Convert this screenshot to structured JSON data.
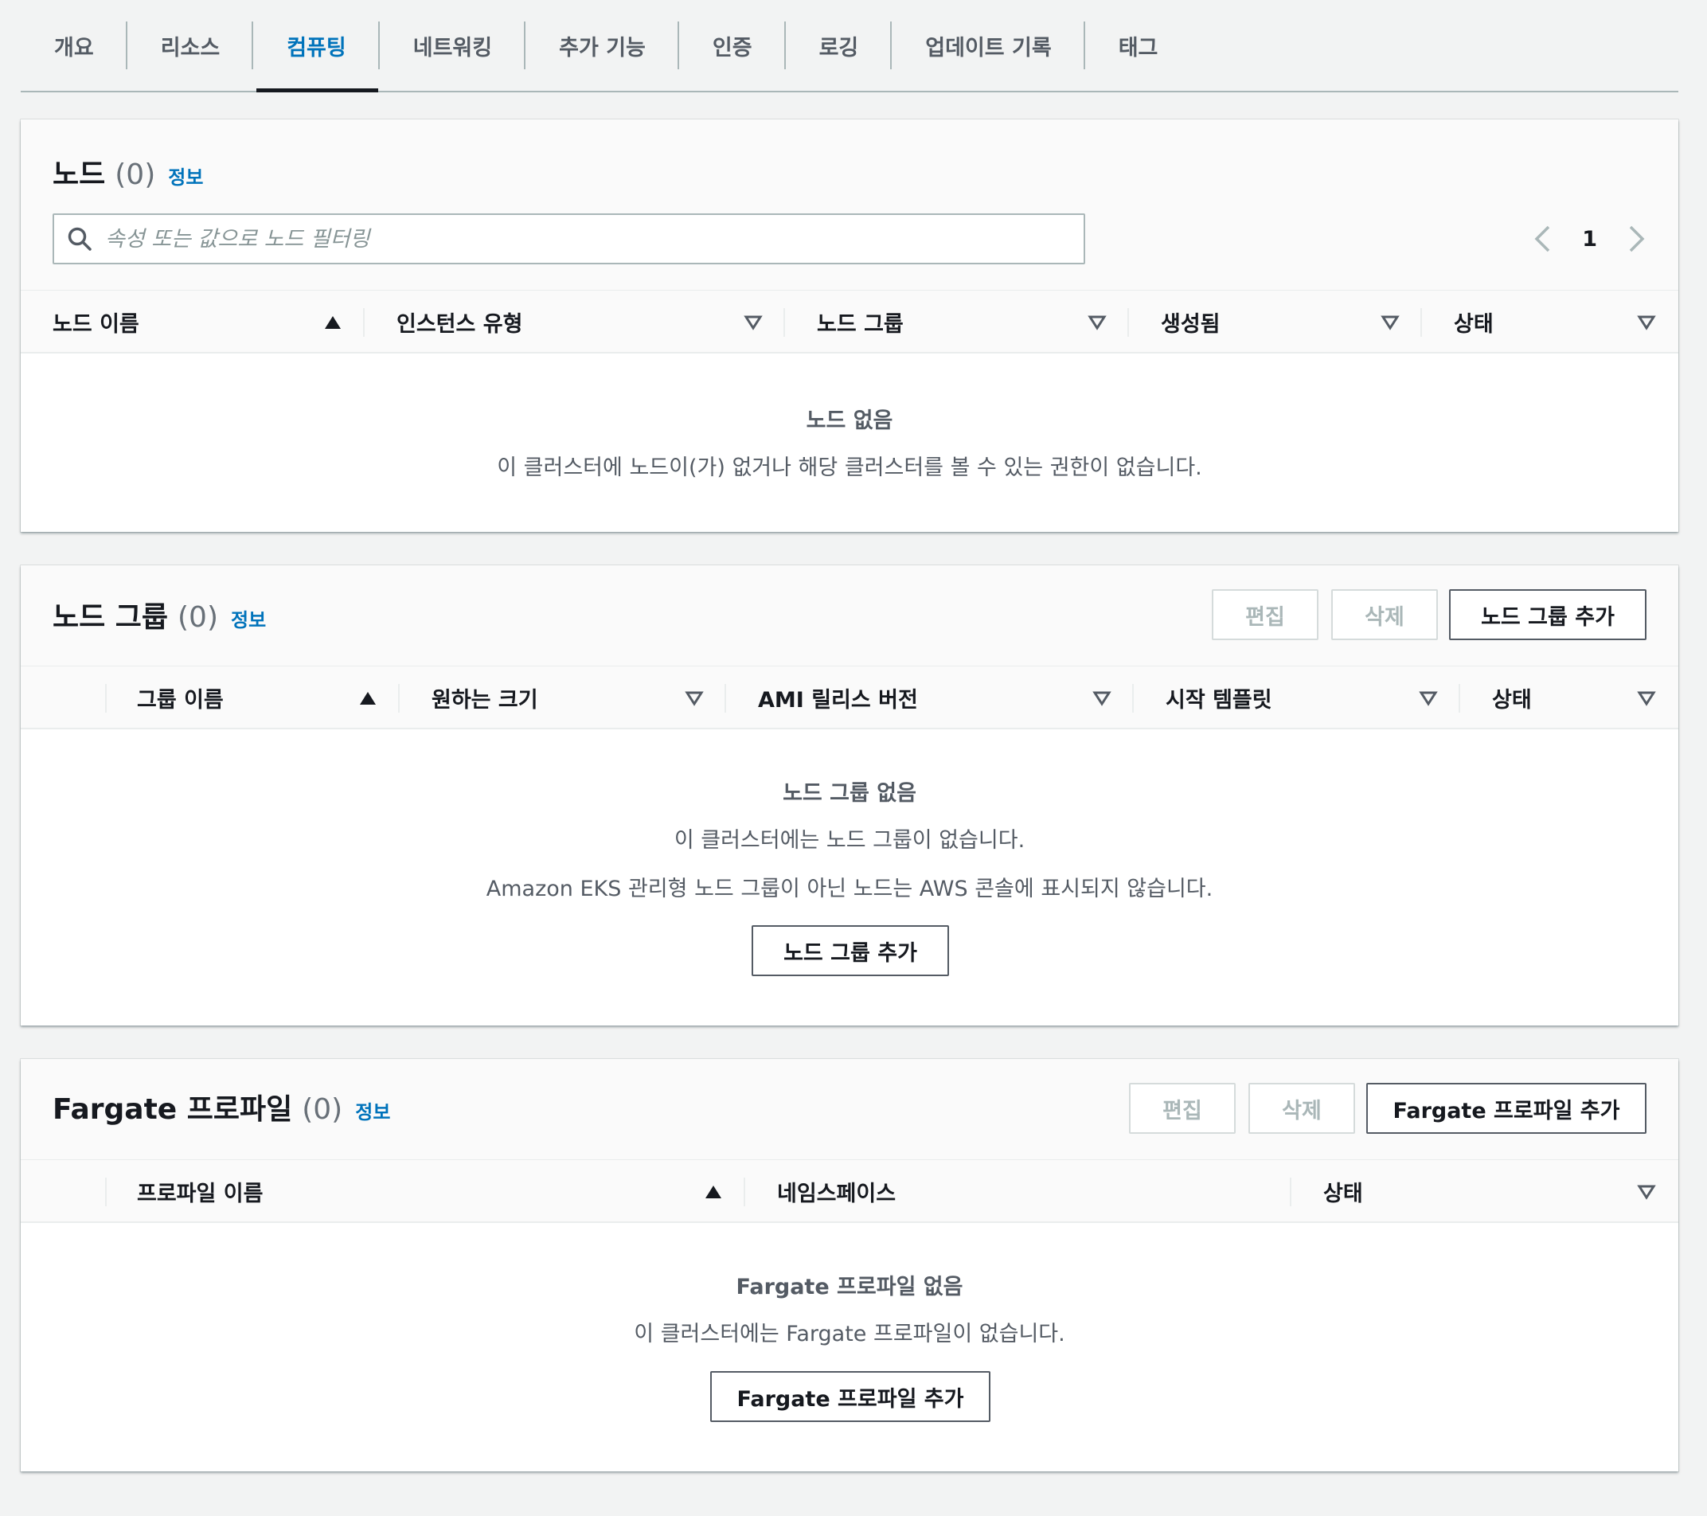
{
  "tabs": [
    {
      "label": "개요"
    },
    {
      "label": "리소스"
    },
    {
      "label": "컴퓨팅",
      "active": true
    },
    {
      "label": "네트워킹"
    },
    {
      "label": "추가 기능"
    },
    {
      "label": "인증"
    },
    {
      "label": "로깅"
    },
    {
      "label": "업데이트 기록"
    },
    {
      "label": "태그"
    }
  ],
  "nodes": {
    "title": "노드",
    "count": "(0)",
    "info": "정보",
    "search_placeholder": "속성 또는 값으로 노드 필터링",
    "page": "1",
    "columns": [
      "노드 이름",
      "인스턴스 유형",
      "노드 그룹",
      "생성됨",
      "상태"
    ],
    "empty_title": "노드 없음",
    "empty_text": "이 클러스터에 노드이(가) 없거나 해당 클러스터를 볼 수 있는 권한이 없습니다."
  },
  "nodegroups": {
    "title": "노드 그룹",
    "count": "(0)",
    "info": "정보",
    "edit": "편집",
    "delete": "삭제",
    "add": "노드 그룹 추가",
    "columns": [
      "그룹 이름",
      "원하는 크기",
      "AMI 릴리스 버전",
      "시작 템플릿",
      "상태"
    ],
    "empty_title": "노드 그룹 없음",
    "empty_text": "이 클러스터에는 노드 그룹이 없습니다.",
    "empty_note": "Amazon EKS 관리형 노드 그룹이 아닌 노드는 AWS 콘솔에 표시되지 않습니다.",
    "empty_button": "노드 그룹 추가"
  },
  "fargate": {
    "title": "Fargate 프로파일",
    "count": "(0)",
    "info": "정보",
    "edit": "편집",
    "delete": "삭제",
    "add": "Fargate 프로파일 추가",
    "columns": [
      "프로파일 이름",
      "네임스페이스",
      "상태"
    ],
    "empty_title": "Fargate 프로파일 없음",
    "empty_text": "이 클러스터에는 Fargate 프로파일이 없습니다.",
    "empty_button": "Fargate 프로파일 추가"
  },
  "colors": {
    "accent": "#0073bb",
    "text": "#16191f",
    "muted": "#545b64",
    "disabled": "#aab7b8",
    "background": "#f2f3f3"
  }
}
